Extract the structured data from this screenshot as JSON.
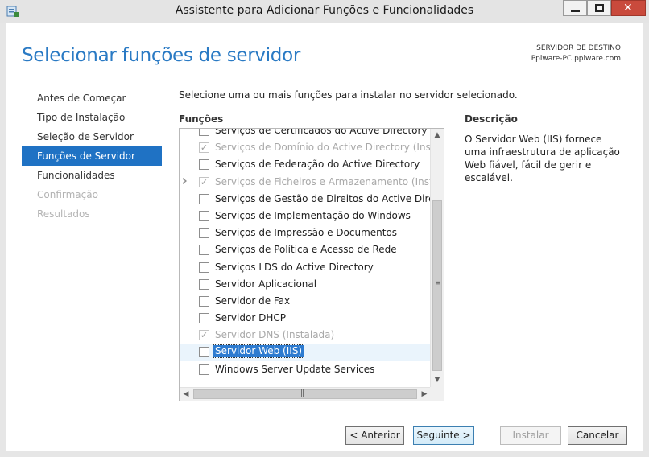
{
  "window": {
    "title": "Assistente para Adicionar Funções e Funcionalidades",
    "icons": {
      "app": "server-manager-icon",
      "minimize": "minimize-icon",
      "maximize": "maximize-icon",
      "close": "close-icon"
    }
  },
  "header": {
    "title": "Selecionar funções de servidor",
    "destination_label": "SERVIDOR DE DESTINO",
    "destination_value": "Pplware-PC.pplware.com"
  },
  "nav": {
    "items": [
      {
        "label": "Antes de Começar",
        "state": "normal"
      },
      {
        "label": "Tipo de Instalação",
        "state": "normal"
      },
      {
        "label": "Seleção de Servidor",
        "state": "normal"
      },
      {
        "label": "Funções de Servidor",
        "state": "active"
      },
      {
        "label": "Funcionalidades",
        "state": "normal"
      },
      {
        "label": "Confirmação",
        "state": "disabled"
      },
      {
        "label": "Resultados",
        "state": "disabled"
      }
    ]
  },
  "main": {
    "instruction": "Selecione uma ou mais funções para instalar no servidor selecionado.",
    "roles_label": "Funções",
    "description_label": "Descrição",
    "description": "O Servidor Web (IIS) fornece uma infraestrutura de aplicação Web fiável, fácil de gerir e escalável."
  },
  "roles": [
    {
      "label": "Serviços de Certificados do Active Directory",
      "checked": false,
      "disabled": false,
      "expander": false,
      "selected": false
    },
    {
      "label": "Serviços de Domínio do Active Directory (Instalada)",
      "checked": true,
      "disabled": true,
      "expander": false,
      "selected": false
    },
    {
      "label": "Serviços de Federação do Active Directory",
      "checked": false,
      "disabled": false,
      "expander": false,
      "selected": false
    },
    {
      "label": "Serviços de Ficheiros e Armazenamento (Instalada)",
      "checked": true,
      "disabled": true,
      "expander": true,
      "selected": false
    },
    {
      "label": "Serviços de Gestão de Direitos do Active Directory",
      "checked": false,
      "disabled": false,
      "expander": false,
      "selected": false
    },
    {
      "label": "Serviços de Implementação do Windows",
      "checked": false,
      "disabled": false,
      "expander": false,
      "selected": false
    },
    {
      "label": "Serviços de Impressão e Documentos",
      "checked": false,
      "disabled": false,
      "expander": false,
      "selected": false
    },
    {
      "label": "Serviços de Política e Acesso de Rede",
      "checked": false,
      "disabled": false,
      "expander": false,
      "selected": false
    },
    {
      "label": "Serviços LDS do Active Directory",
      "checked": false,
      "disabled": false,
      "expander": false,
      "selected": false
    },
    {
      "label": "Servidor Aplicacional",
      "checked": false,
      "disabled": false,
      "expander": false,
      "selected": false
    },
    {
      "label": "Servidor de Fax",
      "checked": false,
      "disabled": false,
      "expander": false,
      "selected": false
    },
    {
      "label": "Servidor DHCP",
      "checked": false,
      "disabled": false,
      "expander": false,
      "selected": false
    },
    {
      "label": "Servidor DNS (Instalada)",
      "checked": true,
      "disabled": true,
      "expander": false,
      "selected": false
    },
    {
      "label": "Servidor Web (IIS)",
      "checked": false,
      "disabled": false,
      "expander": false,
      "selected": true
    },
    {
      "label": "Windows Server Update Services",
      "checked": false,
      "disabled": false,
      "expander": false,
      "selected": false
    }
  ],
  "scrollbars": {
    "up": "▲",
    "down": "▼",
    "left": "◀",
    "right": "▶",
    "vgrip": "≡",
    "hgrip": "|||"
  },
  "footer": {
    "previous": "< Anterior",
    "next": "Seguinte >",
    "install": "Instalar",
    "cancel": "Cancelar"
  },
  "colors": {
    "accent": "#1f72c4",
    "title": "#2a7ac4",
    "selection": "#2d7bd0",
    "close": "#c94a3c"
  }
}
